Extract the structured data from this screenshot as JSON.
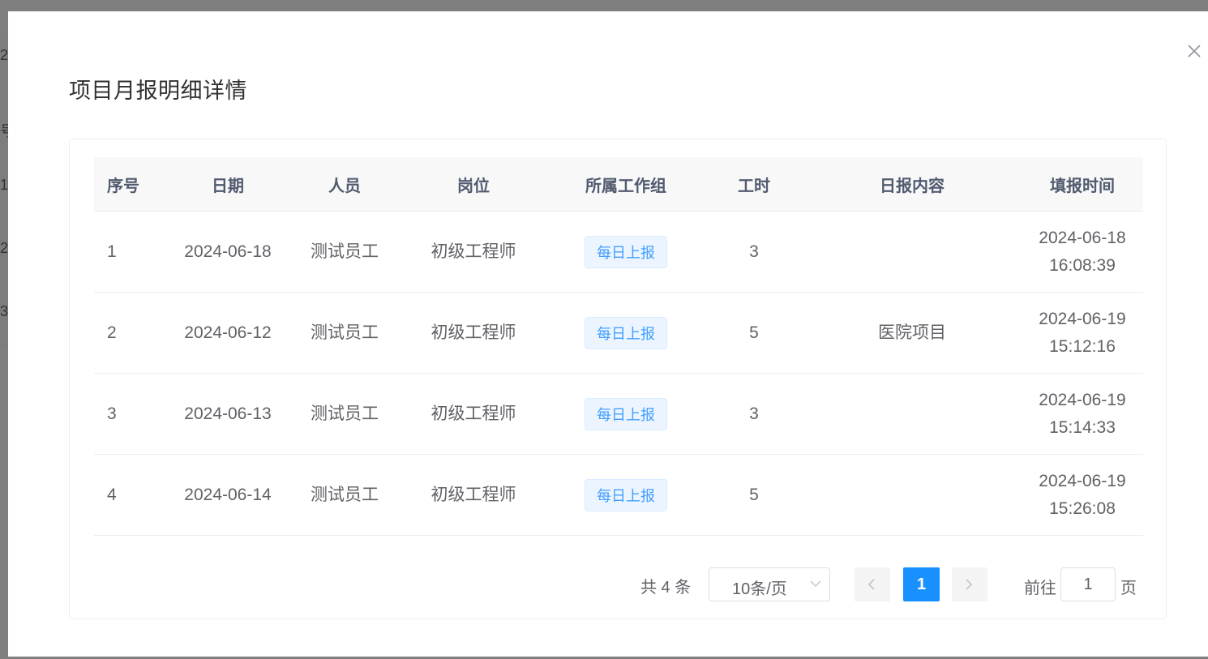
{
  "background": {
    "fragments": [
      "2",
      "号",
      "1",
      "2",
      "3"
    ]
  },
  "dialog": {
    "title": "项目月报明细详情",
    "close_icon": "close-icon"
  },
  "table": {
    "columns": [
      "序号",
      "日期",
      "人员",
      "岗位",
      "所属工作组",
      "工时",
      "日报内容",
      "填报时间"
    ],
    "rows": [
      {
        "index": "1",
        "date": "2024-06-18",
        "person": "测试员工",
        "position": "初级工程师",
        "group": "每日上报",
        "hours": "3",
        "content": "",
        "filled_date": "2024-06-18",
        "filled_time": "16:08:39"
      },
      {
        "index": "2",
        "date": "2024-06-12",
        "person": "测试员工",
        "position": "初级工程师",
        "group": "每日上报",
        "hours": "5",
        "content": "医院项目",
        "filled_date": "2024-06-19",
        "filled_time": "15:12:16"
      },
      {
        "index": "3",
        "date": "2024-06-13",
        "person": "测试员工",
        "position": "初级工程师",
        "group": "每日上报",
        "hours": "3",
        "content": "",
        "filled_date": "2024-06-19",
        "filled_time": "15:14:33"
      },
      {
        "index": "4",
        "date": "2024-06-14",
        "person": "测试员工",
        "position": "初级工程师",
        "group": "每日上报",
        "hours": "5",
        "content": "",
        "filled_date": "2024-06-19",
        "filled_time": "15:26:08"
      }
    ]
  },
  "pagination": {
    "total": "共 4 条",
    "page_size": "10条/页",
    "current_page": "1",
    "goto_label": "前往",
    "goto_value": "1",
    "page_suffix": "页"
  },
  "colors": {
    "accent": "#1890ff",
    "tag_text": "#409eff",
    "tag_bg": "#ecf5ff"
  }
}
